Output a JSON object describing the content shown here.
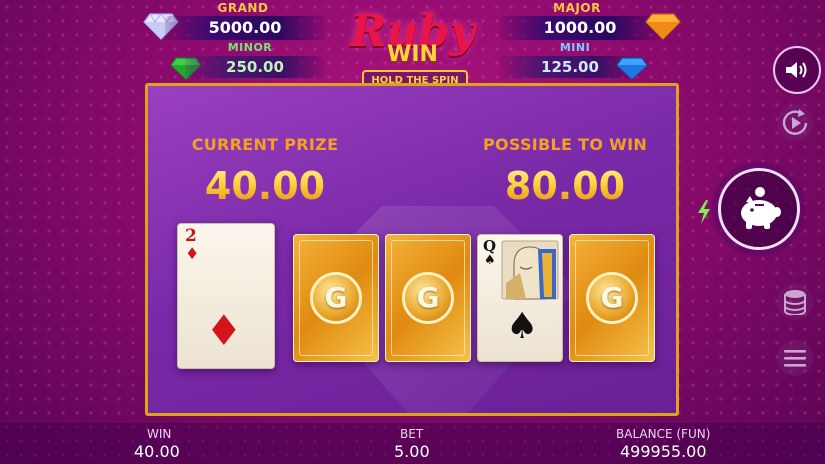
{
  "jackpots": {
    "grand": {
      "label": "GRAND",
      "value": "5000.00"
    },
    "major": {
      "label": "MAJOR",
      "value": "1000.00"
    },
    "minor": {
      "label": "MINOR",
      "value": "250.00"
    },
    "mini": {
      "label": "MINI",
      "value": "125.00"
    }
  },
  "logo": {
    "title": "Ruby",
    "subtitle": "WIN",
    "tagline": "HOLD THE SPIN"
  },
  "game": {
    "current_prize_label": "CURRENT PRIZE",
    "current_prize_value": "40.00",
    "possible_win_label": "POSSIBLE TO WIN",
    "possible_win_value": "80.00",
    "cards": [
      {
        "state": "face",
        "rank": "2",
        "suit": "diamonds",
        "suit_glyph": "♦"
      },
      {
        "state": "back",
        "logo": "G"
      },
      {
        "state": "back",
        "logo": "G"
      },
      {
        "state": "face",
        "rank": "Q",
        "suit": "spades",
        "suit_glyph": "♠"
      },
      {
        "state": "back",
        "logo": "G"
      }
    ]
  },
  "side_controls": {
    "sound": "speaker-icon",
    "autoplay": "play-icon",
    "collect": "piggy-bank-icon",
    "bet": "coins-stack-icon",
    "menu": "hamburger-icon"
  },
  "footer": {
    "win_label": "WIN",
    "win_value": "40.00",
    "bet_label": "BET",
    "bet_value": "5.00",
    "balance_label": "BALANCE (FUN)",
    "balance_value": "499955.00"
  },
  "colors": {
    "background": "#8a0a6c",
    "panel": "#7a2aa8",
    "gold": "#ffcf3a",
    "panel_border": "#e0a21d"
  }
}
